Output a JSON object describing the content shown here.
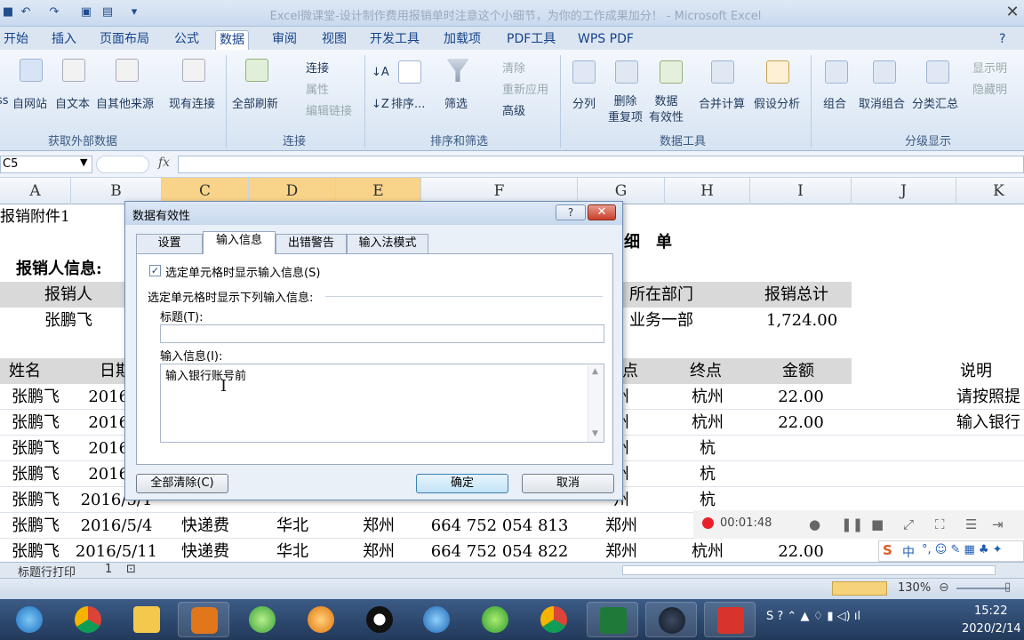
{
  "window": {
    "title": "Excel微课堂-设计制作费用报销单时注意这个小细节，为你的工作成果加分！ - Microsoft Excel"
  },
  "ribbon": {
    "tabs": [
      "开始",
      "插入",
      "页面布局",
      "公式",
      "数据",
      "审阅",
      "视图",
      "开发工具",
      "加载项",
      "PDF工具",
      "WPS PDF"
    ],
    "active_tab": "数据",
    "groups": {
      "external": {
        "label": "获取外部数据",
        "buttons": [
          "ss",
          "自网站",
          "自文本",
          "自其他来源",
          "现有连接"
        ]
      },
      "connections": {
        "label": "连接",
        "refresh": "全部刷新",
        "items": [
          "连接",
          "属性",
          "编辑链接"
        ]
      },
      "sort": {
        "label": "排序和筛选",
        "sort": "排序...",
        "filter": "筛选",
        "items": [
          "清除",
          "重新应用",
          "高级"
        ]
      },
      "tools": {
        "label": "数据工具",
        "buttons": [
          "分列",
          "删除\n重复项",
          "数据\n有效性",
          "合并计算",
          "假设分析"
        ]
      },
      "outline": {
        "label": "分级显示",
        "buttons": [
          "组合",
          "取消组合",
          "分类汇总"
        ],
        "items": [
          "显示明",
          "隐藏明"
        ]
      }
    }
  },
  "formula_bar": {
    "name_box": "C5",
    "fx": "fx"
  },
  "columns": [
    "A",
    "B",
    "C",
    "D",
    "E",
    "F",
    "G",
    "H",
    "I",
    "J",
    "K"
  ],
  "sheet": {
    "a1": "报销附件1",
    "heading_fragment": "细　单",
    "section": "报销人信息:",
    "header_person": "报销人",
    "header_dept": "所在部门",
    "header_total": "报销总计",
    "person": "张鹏飞",
    "dept": "业务一部",
    "total": "1,724.00",
    "table_headers": {
      "name": "姓名",
      "date": "日期",
      "point": "点",
      "end": "终点",
      "amount": "金额",
      "note": "说明"
    },
    "rows": [
      {
        "name": "张鹏飞",
        "date": "2016/4",
        "type": "",
        "region": "",
        "city": "",
        "acct": "",
        "start": "州",
        "end": "杭州",
        "amount": "22.00",
        "note": "请按照提"
      },
      {
        "name": "张鹏飞",
        "date": "2016/4",
        "type": "",
        "region": "",
        "city": "",
        "acct": "",
        "start": "州",
        "end": "杭州",
        "amount": "22.00",
        "note": "输入银行"
      },
      {
        "name": "张鹏飞",
        "date": "2016/4",
        "type": "",
        "region": "",
        "city": "",
        "acct": "",
        "start": "州",
        "end": "杭",
        "amount": "",
        "note": ""
      },
      {
        "name": "张鹏飞",
        "date": "2016/4",
        "type": "",
        "region": "",
        "city": "",
        "acct": "",
        "start": "州",
        "end": "杭",
        "amount": "",
        "note": ""
      },
      {
        "name": "张鹏飞",
        "date": "2016/5/1",
        "type": "",
        "region": "",
        "city": "",
        "acct": "",
        "start": "州",
        "end": "杭",
        "amount": "",
        "note": ""
      },
      {
        "name": "张鹏飞",
        "date": "2016/5/4",
        "type": "快递费",
        "region": "华北",
        "city": "郑州",
        "acct": "664 752 054 813",
        "start": "郑州",
        "end": "杭",
        "amount": "",
        "note": ""
      },
      {
        "name": "张鹏飞",
        "date": "2016/5/11",
        "type": "快递费",
        "region": "华北",
        "city": "郑州",
        "acct": "664 752 054 822",
        "start": "郑州",
        "end": "杭州",
        "amount": "22.00",
        "note": ""
      }
    ]
  },
  "dialog": {
    "title": "数据有效性",
    "help": "?",
    "tabs": [
      "设置",
      "输入信息",
      "出错警告",
      "输入法模式"
    ],
    "active_tab": "输入信息",
    "checkbox_label": "选定单元格时显示输入信息(S)",
    "checkbox_checked": "✓",
    "section_label": "选定单元格时显示下列输入信息:",
    "title_label": "标题(T):",
    "title_value": "",
    "message_label": "输入信息(I):",
    "message_value": "输入银行账号前",
    "clear_all": "全部清除(C)",
    "ok": "确定",
    "cancel": "取消"
  },
  "recorder": {
    "time": "00:01:48"
  },
  "sheet_tabs": [
    "标题行打印",
    "1"
  ],
  "status": {
    "zoom": "130%"
  },
  "clock": {
    "time": "15:22",
    "date": "2020/2/14"
  }
}
